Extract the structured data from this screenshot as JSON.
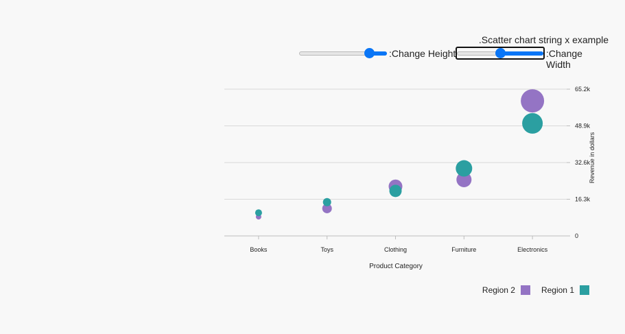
{
  "header": {
    "title": ".Scatter chart string x example",
    "height_label": ":Change Height",
    "width_label": ":Change Width",
    "height_value": 0.8,
    "width_value": 0.5
  },
  "chart_data": {
    "type": "scatter",
    "xlabel": "Product Category",
    "ylabel": "Revenue in dollars",
    "categories": [
      "Books",
      "Toys",
      "Clothing",
      "Furniture",
      "Electronics"
    ],
    "ylim": [
      0,
      65200
    ],
    "yticks": [
      "0",
      "16.3k",
      "32.6k",
      "48.9k",
      "65.2k"
    ],
    "ytick_values": [
      0,
      16300,
      32600,
      48900,
      65200
    ],
    "grid": true,
    "legend_position": "bottom-right",
    "series": [
      {
        "name": "Region 2",
        "color": "#9474c4",
        "values": [
          8500,
          12200,
          22000,
          25000,
          60000
        ],
        "sizes": [
          4,
          7,
          10,
          11,
          17
        ]
      },
      {
        "name": "Region 1",
        "color": "#2b9fa1",
        "values": [
          10300,
          15000,
          20000,
          30000,
          50000
        ],
        "sizes": [
          5,
          6,
          9,
          12,
          15
        ]
      }
    ]
  }
}
